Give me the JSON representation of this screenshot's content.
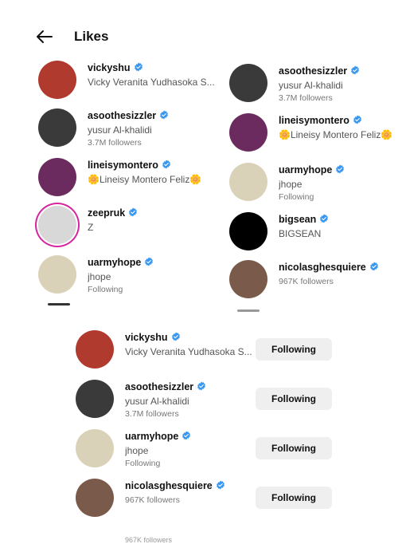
{
  "header": {
    "title": "Likes",
    "back_icon": "arrow-left-icon"
  },
  "grid_left": [
    {
      "username": "vickyshu",
      "subtitle": "Vicky Veranita Yudhasoka S...",
      "meta": "",
      "avatar_color": "#b03a2e"
    },
    {
      "username": "asoothesizzler",
      "subtitle": "yusur Al-khalidi",
      "meta": "3.7M followers",
      "avatar_color": "#3a3a3a"
    },
    {
      "username": "lineisymontero",
      "subtitle": "🌼Lineisy Montero Feliz🌼",
      "meta": "",
      "avatar_color": "#6b2b5f"
    },
    {
      "username": "zeepruk",
      "subtitle": "Z",
      "meta": "",
      "avatar_color": "#d8d8d8"
    },
    {
      "username": "uarmyhope",
      "subtitle": "jhope",
      "meta": "Following",
      "avatar_color": "#d9d2b8"
    }
  ],
  "grid_right": [
    {
      "username": "asoothesizzler",
      "subtitle": "yusur Al-khalidi",
      "meta": "3.7M followers",
      "avatar_color": "#3a3a3a"
    },
    {
      "username": "lineisymontero",
      "subtitle": "🌼Lineisy Montero Feliz🌼",
      "meta": "",
      "avatar_color": "#6b2b5f"
    },
    {
      "username": "uarmyhope",
      "subtitle": "jhope",
      "meta": "Following",
      "avatar_color": "#d9d2b8"
    },
    {
      "username": "bigsean",
      "subtitle": "BIGSEAN",
      "meta": "",
      "avatar_color": "#000000"
    },
    {
      "username": "nicolasghesquiere",
      "subtitle": "",
      "meta": "967K followers",
      "avatar_color": "#7a5a4a"
    }
  ],
  "bottom_list": [
    {
      "username": "vickyshu",
      "subtitle": "Vicky Veranita Yudhasoka S...",
      "meta": "",
      "button": "Following",
      "avatar_color": "#b03a2e"
    },
    {
      "username": "asoothesizzler",
      "subtitle": "yusur Al-khalidi",
      "meta": "3.7M followers",
      "button": "Following",
      "avatar_color": "#3a3a3a"
    },
    {
      "username": "uarmyhope",
      "subtitle": "jhope",
      "meta": "Following",
      "button": "Following",
      "avatar_color": "#d9d2b8"
    },
    {
      "username": "nicolasghesquiere",
      "subtitle": "",
      "meta": "967K followers",
      "button": "Following",
      "avatar_color": "#7a5a4a"
    }
  ],
  "peek_text": "967K followers",
  "colors": {
    "verified": "#3897f0",
    "button_bg": "#efefef",
    "story_ring": "#d6249f"
  }
}
